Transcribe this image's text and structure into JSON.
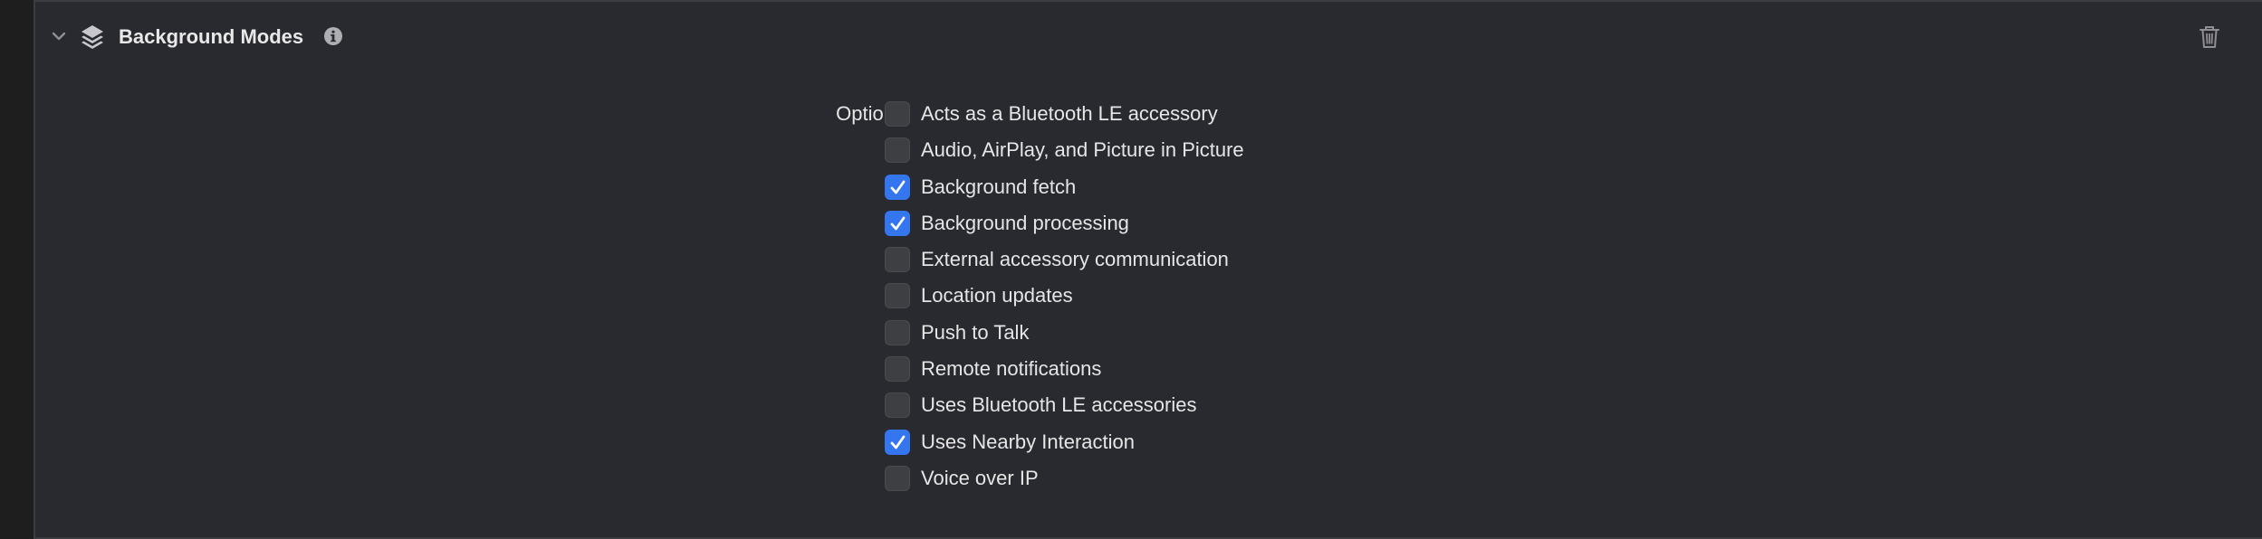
{
  "section": {
    "title": "Background Modes",
    "icons": {
      "collapse": "chevron-down-icon",
      "capability": "layers-icon",
      "info": "info-icon",
      "delete": "trash-icon"
    }
  },
  "options": {
    "label": "Options",
    "items": [
      {
        "label": "Acts as a Bluetooth LE accessory",
        "checked": false
      },
      {
        "label": "Audio, AirPlay, and Picture in Picture",
        "checked": false
      },
      {
        "label": "Background fetch",
        "checked": true
      },
      {
        "label": "Background processing",
        "checked": true
      },
      {
        "label": "External accessory communication",
        "checked": false
      },
      {
        "label": "Location updates",
        "checked": false
      },
      {
        "label": "Push to Talk",
        "checked": false
      },
      {
        "label": "Remote notifications",
        "checked": false
      },
      {
        "label": "Uses Bluetooth LE accessories",
        "checked": false
      },
      {
        "label": "Uses Nearby Interaction",
        "checked": true
      },
      {
        "label": "Voice over IP",
        "checked": false
      }
    ]
  },
  "colors": {
    "background": "#292a2f",
    "accent": "#3476f0",
    "text": "#e6e6e6",
    "checkbox_off": "#3e3f43"
  }
}
